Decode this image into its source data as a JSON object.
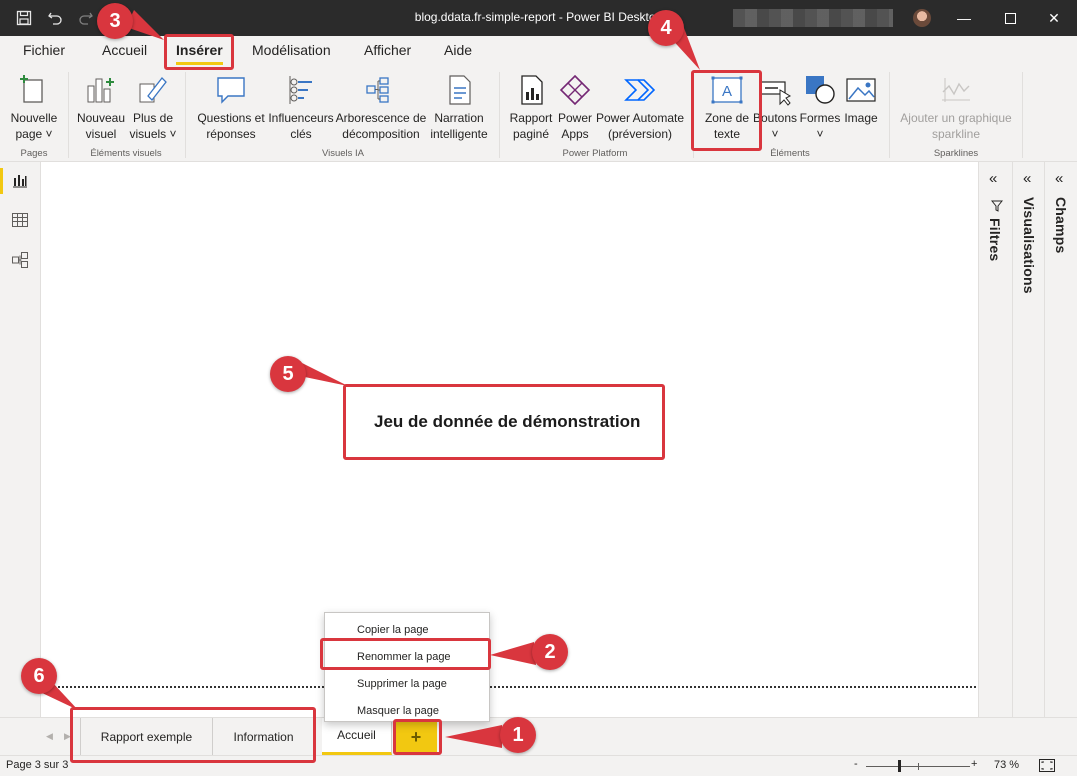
{
  "window": {
    "title": "blog.ddata.fr-simple-report - Power BI Desktop",
    "minimize_icon": "minimize-icon",
    "maximize_icon": "maximize-icon",
    "close_icon": "close-icon"
  },
  "ribbon_tabs": [
    {
      "label": "Fichier"
    },
    {
      "label": "Accueil"
    },
    {
      "label": "Insérer"
    },
    {
      "label": "Modélisation"
    },
    {
      "label": "Afficher"
    },
    {
      "label": "Aide"
    }
  ],
  "ribbon": {
    "pages": {
      "new_page_line1": "Nouvelle",
      "new_page_line2": "page",
      "group": "Pages"
    },
    "visuals": {
      "new_visual_line1": "Nouveau",
      "new_visual_line2": "visuel",
      "more_visuals_line1": "Plus de",
      "more_visuals_line2": "visuels",
      "group": "Éléments visuels"
    },
    "ai": {
      "qa_line1": "Questions et",
      "qa_line2": "réponses",
      "influencers_line1": "Influenceurs",
      "influencers_line2": "clés",
      "decomp_line1": "Arborescence de",
      "decomp_line2": "décomposition",
      "narrative_line1": "Narration",
      "narrative_line2": "intelligente",
      "group": "Visuels IA"
    },
    "power_platform": {
      "paginated_line1": "Rapport",
      "paginated_line2": "paginé",
      "apps_line1": "Power",
      "apps_line2": "Apps",
      "automate_line1": "Power Automate",
      "automate_line2": "(préversion)",
      "group": "Power Platform"
    },
    "elements": {
      "textbox_line1": "Zone de",
      "textbox_line2": "texte",
      "buttons": "Boutons",
      "shapes": "Formes",
      "image": "Image",
      "group": "Éléments"
    },
    "sparklines": {
      "add_line1": "Ajouter un graphique",
      "add_line2": "sparkline",
      "group": "Sparklines"
    }
  },
  "panes": {
    "filters": "Filtres",
    "visualizations": "Visualisations",
    "fields": "Champs"
  },
  "canvas": {
    "textbox_text": "Jeu de donnée de démonstration"
  },
  "context_menu": [
    "Copier la page",
    "Renommer la page",
    "Supprimer la page",
    "Masquer la page"
  ],
  "page_tabs": [
    {
      "label": "Rapport exemple"
    },
    {
      "label": "Information"
    },
    {
      "label": "Accueil"
    }
  ],
  "add_page_symbol": "+",
  "status": {
    "page_info": "Page 3 sur 3",
    "zoom_minus": "-",
    "zoom_plus": "+",
    "zoom_level": "73 %"
  },
  "annotations": [
    "1",
    "2",
    "3",
    "4",
    "5",
    "6"
  ],
  "colors": {
    "accent_yellow": "#f2c811",
    "annotation_red": "#d9363e",
    "titlebar": "#2b2b2b"
  }
}
